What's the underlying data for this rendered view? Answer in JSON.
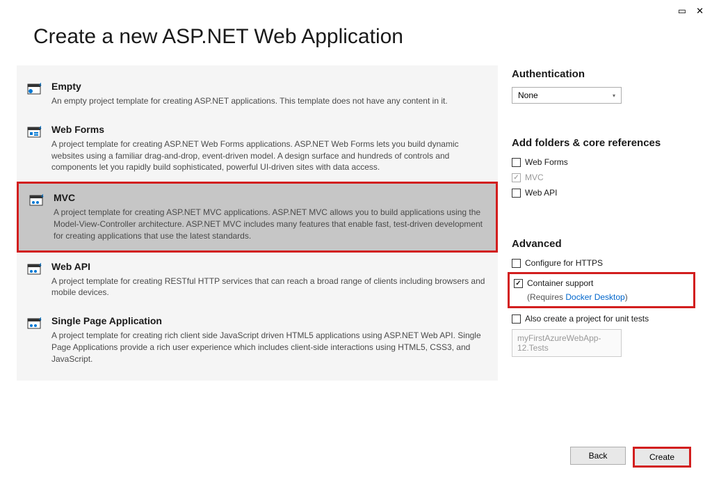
{
  "window": {
    "title": "Create a new ASP.NET Web Application"
  },
  "templates": [
    {
      "title": "Empty",
      "desc": "An empty project template for creating ASP.NET applications. This template does not have any content in it."
    },
    {
      "title": "Web Forms",
      "desc": "A project template for creating ASP.NET Web Forms applications. ASP.NET Web Forms lets you build dynamic websites using a familiar drag-and-drop, event-driven model. A design surface and hundreds of controls and components let you rapidly build sophisticated, powerful UI-driven sites with data access."
    },
    {
      "title": "MVC",
      "desc": "A project template for creating ASP.NET MVC applications. ASP.NET MVC allows you to build applications using the Model-View-Controller architecture. ASP.NET MVC includes many features that enable fast, test-driven development for creating applications that use the latest standards."
    },
    {
      "title": "Web API",
      "desc": "A project template for creating RESTful HTTP services that can reach a broad range of clients including browsers and mobile devices."
    },
    {
      "title": "Single Page Application",
      "desc": "A project template for creating rich client side JavaScript driven HTML5 applications using ASP.NET Web API. Single Page Applications provide a rich user experience which includes client-side interactions using HTML5, CSS3, and JavaScript."
    }
  ],
  "authentication": {
    "heading": "Authentication",
    "value": "None"
  },
  "folders": {
    "heading": "Add folders & core references",
    "webforms": "Web Forms",
    "mvc": "MVC",
    "webapi": "Web API"
  },
  "advanced": {
    "heading": "Advanced",
    "https": "Configure for HTTPS",
    "container": "Container support",
    "requires_prefix": "(Requires ",
    "requires_link": "Docker Desktop",
    "requires_suffix": ")",
    "unittests": "Also create a project for unit tests",
    "testproject": "myFirstAzureWebApp-12.Tests"
  },
  "buttons": {
    "back": "Back",
    "create": "Create"
  }
}
